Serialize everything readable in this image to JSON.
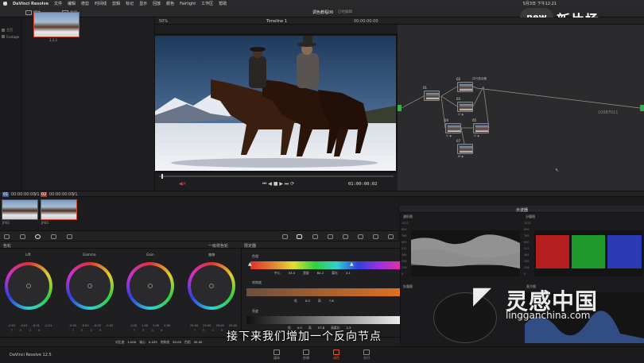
{
  "menubar": {
    "app": "DaVinci Resolve",
    "items": [
      "文件",
      "编辑",
      "修剪",
      "时间线",
      "剪辑",
      "标记",
      "显示",
      "回放",
      "颜色",
      "Fairlight",
      "工作区",
      "帮助"
    ],
    "clock": "5月3日 下午12:21"
  },
  "toolbar": {
    "media_pool": "媒体",
    "clip_label": "片段",
    "project_title": "调色教程06",
    "project_sub": "已经编辑",
    "zoom": "50%",
    "timeline": "Timeline 1",
    "timecode_top": "00:00:00:00",
    "clip_mode": "片段"
  },
  "watermark_top": {
    "logo": "new",
    "text": "新片场"
  },
  "left_tree": {
    "items": [
      "主页",
      "Footage"
    ]
  },
  "media": {
    "thumb_label": "1,2,1"
  },
  "viewer": {
    "timecode": "01:00:00:02"
  },
  "node_graph": {
    "node_id": "10087011",
    "nodes": [
      {
        "num": "01",
        "label": ""
      },
      {
        "num": "02",
        "label": "并行混合器"
      },
      {
        "num": "03",
        "label": "∅ ◈"
      },
      {
        "num": "04",
        "label": "∅ ◈"
      },
      {
        "num": "05",
        "label": "∅ ◈"
      },
      {
        "num": "06",
        "label": "∅ ◈"
      },
      {
        "num": "07",
        "label": "M ◈"
      }
    ]
  },
  "clips": {
    "bar_left": "01",
    "tc1": "00:00:00:00",
    "v1": "V1",
    "bar_mid": "02",
    "tc2": "00:00:00:00",
    "v2": "V1",
    "items": [
      {
        "label": "JPEG"
      },
      {
        "label": "JPEG"
      }
    ]
  },
  "wheels": {
    "title": "色轮",
    "mode": "一级校色轮",
    "items": [
      {
        "name": "Lift",
        "vals": [
          "-0.01",
          "-0.01",
          "-0.01",
          "-0.01"
        ]
      },
      {
        "name": "Gamma",
        "vals": [
          "-0.02",
          "-0.02",
          "-0.02",
          "-0.02"
        ]
      },
      {
        "name": "Gain",
        "vals": [
          "1.00",
          "1.00",
          "1.00",
          "1.00"
        ]
      },
      {
        "name": "偏移",
        "vals": [
          "25.00",
          "25.00",
          "25.00",
          "25.00"
        ]
      }
    ],
    "rgb": [
      "Y",
      "R",
      "G",
      "B"
    ]
  },
  "qualifier": {
    "title": "限定器",
    "hue_label": "色相",
    "hue_vals": [
      {
        "k": "中心",
        "v": "33.0"
      },
      {
        "k": "宽度",
        "v": "60.2"
      },
      {
        "k": "柔化",
        "v": "3.1"
      }
    ],
    "sat_label": "饱和度",
    "sat_vals": [
      {
        "k": "低",
        "v": "0.0"
      },
      {
        "k": "高",
        "v": "7.6"
      }
    ],
    "lum_label": "亮度",
    "lum_vals": [
      {
        "k": "低",
        "v": "0.0"
      },
      {
        "k": "高",
        "v": "57.8"
      },
      {
        "k": "高柔化",
        "v": "2.5"
      }
    ]
  },
  "scopes": {
    "title": "示波器",
    "wave_title": "波形图",
    "parade_title": "分量图",
    "vec_title": "矢量图",
    "histo_title": "直方图",
    "scale": [
      "1023",
      "896",
      "768",
      "640",
      "512",
      "384",
      "256",
      "128",
      "0"
    ]
  },
  "status": {
    "items": [
      {
        "k": "对比度",
        "v": "1.000"
      },
      {
        "k": "轴心",
        "v": "0.435"
      },
      {
        "k": "饱和度",
        "v": "50.00"
      },
      {
        "k": "色相",
        "v": "50.00"
      }
    ]
  },
  "pagebar": {
    "app": "DaVinci Resolve 12.5",
    "tabs": [
      "媒体",
      "剪辑",
      "调色",
      "交付"
    ]
  },
  "subtitle": "接下来我们增加一个反向节点",
  "watermark_bottom": {
    "cn": "灵感中国",
    "url": "lingganchina.com"
  }
}
